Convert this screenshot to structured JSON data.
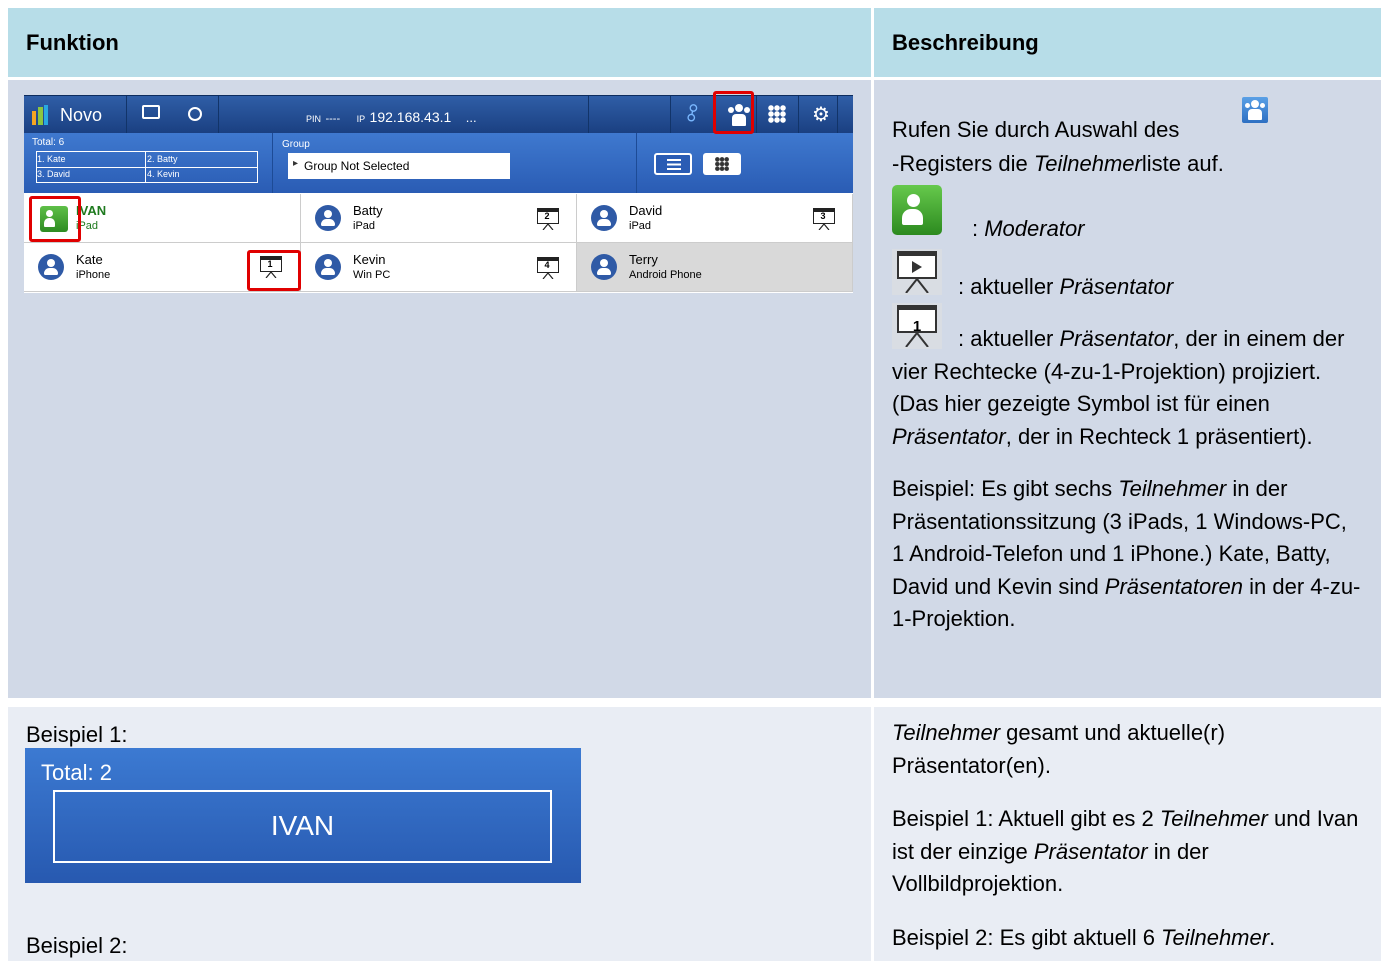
{
  "table": {
    "header": {
      "col1": "Funktion",
      "col2": "Beschreibung"
    }
  },
  "novo": {
    "app_name": "Novo",
    "pin_label": "PIN",
    "pin_value": "----",
    "ip_label": "IP",
    "ip_value": "192.168.43.1",
    "more": "...",
    "total_label": "Total: 6",
    "presenters": [
      "1. Kate",
      "2. Batty",
      "3. David",
      "4. Kevin"
    ],
    "group_label": "Group",
    "group_value": "Group Not Selected",
    "participants": [
      {
        "name": "IVAN",
        "device": "iPad"
      },
      {
        "name": "Batty",
        "device": "iPad",
        "slot": "2"
      },
      {
        "name": "David",
        "device": "iPad",
        "slot": "3"
      },
      {
        "name": "Kate",
        "device": "iPhone",
        "slot": "1"
      },
      {
        "name": "Kevin",
        "device": "Win PC",
        "slot": "4"
      },
      {
        "name": "Terry",
        "device": "Android Phone"
      }
    ],
    "colors": {
      "topbar": "#1f4a8f",
      "groupbar": "#3470c4",
      "highlight": "#e00000"
    }
  },
  "row1": {
    "desc1_a": "Rufen Sie durch Auswahl des",
    "desc1_b": "-Registers die ",
    "desc1_b_em": "Teilnehmer",
    "desc1_b_end": "liste auf.",
    "moderator_prefix": ": ",
    "moderator": "Moderator",
    "presenter_prefix": ": aktueller ",
    "presenter": "Präsentator",
    "presenter4_prefix": ": aktueller ",
    "presenter4_em": "Präsentator",
    "presenter4_rest": ", der in einem der vier Rechtecke (4-zu-1-Projektion) projiziert. (Das hier gezeigte Symbol ist für einen ",
    "presenter4_em2": "Präsentator",
    "presenter4_end": ", der in Rechteck 1 präsentiert).",
    "example_a": "Beispiel: Es gibt sechs ",
    "example_em": "Teilnehmer",
    "example_b": " in der Präsentationssitzung (3 iPads, 1 Windows-PC, 1 Android-Telefon und 1 iPhone.) Kate, Batty, David und Kevin sind ",
    "example_em2": "Präsentatoren",
    "example_c": " in der 4-zu-1-Projektion."
  },
  "row2": {
    "bsp1_label": "Beispiel 1:",
    "bsp1_total": "Total: 2",
    "bsp1_name": "IVAN",
    "bsp2_label": "Beispiel 2:",
    "d1_em": "Teilnehmer",
    "d1_rest": " gesamt und aktuelle(r) Präsentator(en).",
    "d2_a": "Beispiel 1: Aktuell gibt es 2 ",
    "d2_em": "Teilnehmer",
    "d2_b": " und Ivan ist der einzige ",
    "d2_em2": "Präsentator",
    "d2_c": " in der Vollbildprojektion.",
    "d3_a": "Beispiel 2: Es gibt aktuell 6 ",
    "d3_em": "Teilnehmer",
    "d3_b": "."
  }
}
